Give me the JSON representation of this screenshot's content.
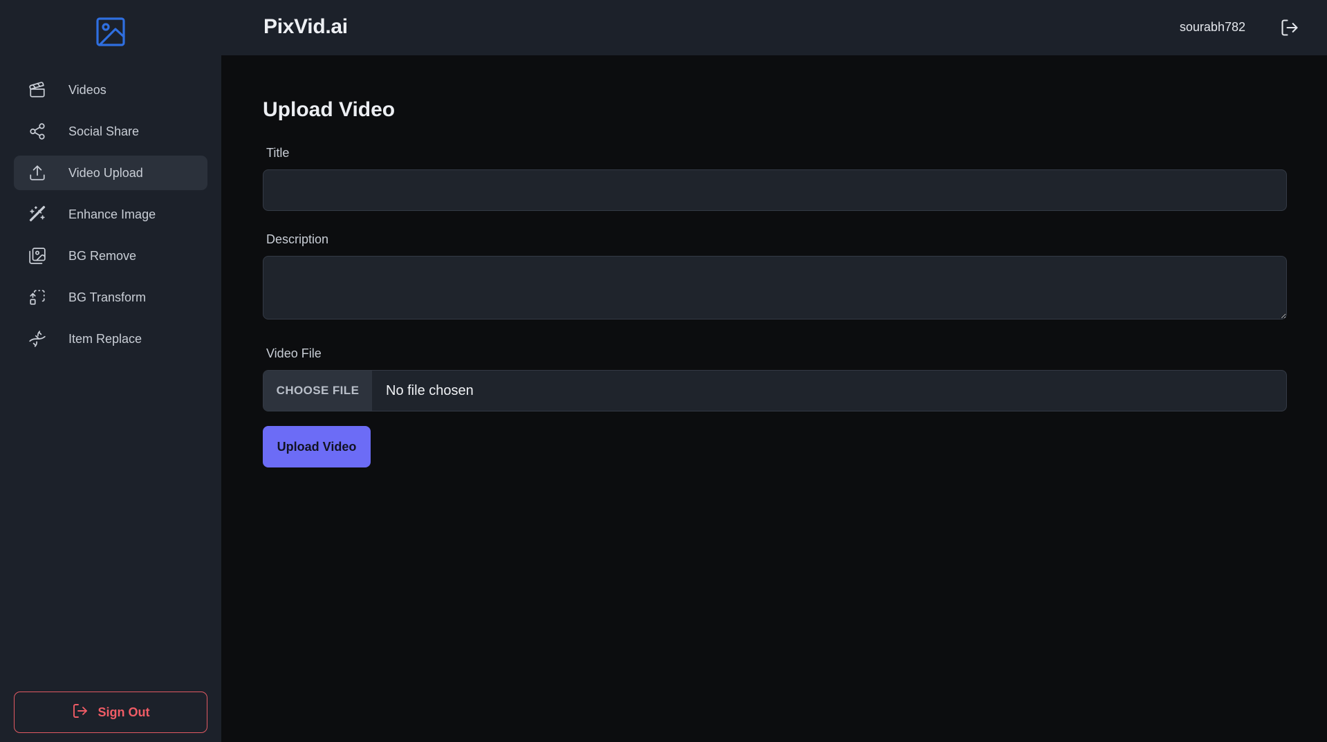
{
  "app": {
    "brand": "PixVid.ai"
  },
  "header": {
    "username": "sourabh782"
  },
  "sidebar": {
    "items": [
      {
        "label": "Videos",
        "icon": "clapperboard-icon",
        "active": false
      },
      {
        "label": "Social Share",
        "icon": "share-icon",
        "active": false
      },
      {
        "label": "Video Upload",
        "icon": "upload-icon",
        "active": true
      },
      {
        "label": "Enhance Image",
        "icon": "magic-wand-icon",
        "active": false
      },
      {
        "label": "BG Remove",
        "icon": "images-icon",
        "active": false
      },
      {
        "label": "BG Transform",
        "icon": "transform-icon",
        "active": false
      },
      {
        "label": "Item Replace",
        "icon": "dna-icon",
        "active": false
      }
    ],
    "signout_label": "Sign Out"
  },
  "main": {
    "title": "Upload Video",
    "title_field": {
      "label": "Title",
      "value": ""
    },
    "description_field": {
      "label": "Description",
      "value": ""
    },
    "file_field": {
      "label": "Video File",
      "button": "CHOOSE FILE",
      "status": "No file chosen"
    },
    "submit_label": "Upload Video"
  },
  "colors": {
    "sidebar_bg": "#1c212a",
    "main_bg": "#0c0d0f",
    "accent": "#6c6cf6",
    "logo_blue": "#2f6fe0",
    "danger": "#f05c66"
  }
}
